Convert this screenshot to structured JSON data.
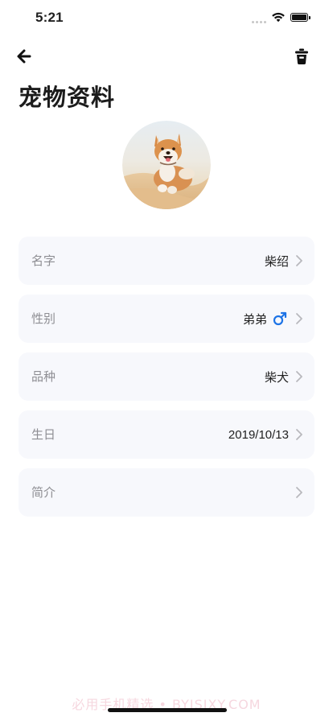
{
  "status_bar": {
    "time": "5:21"
  },
  "page": {
    "title": "宠物资料"
  },
  "pet_info": [
    {
      "label": "名字",
      "value": "柴绍",
      "icon": "chevron-right-icon"
    },
    {
      "label": "性别",
      "value": "弟弟",
      "icon": "male-icon",
      "icon_color": "#1e74e6"
    },
    {
      "label": "品种",
      "value": "柴犬",
      "icon": "chevron-right-icon"
    },
    {
      "label": "生日",
      "value": "2019/10/13",
      "icon": "chevron-right-icon"
    },
    {
      "label": "简介",
      "value": "",
      "icon": "chevron-right-icon"
    }
  ],
  "watermark": "必用手机精选 • BYJSJXY.COM",
  "colors": {
    "row_background": "#f7f8fc",
    "label_text": "#8e8e93",
    "accent_blue": "#1e74e6"
  }
}
